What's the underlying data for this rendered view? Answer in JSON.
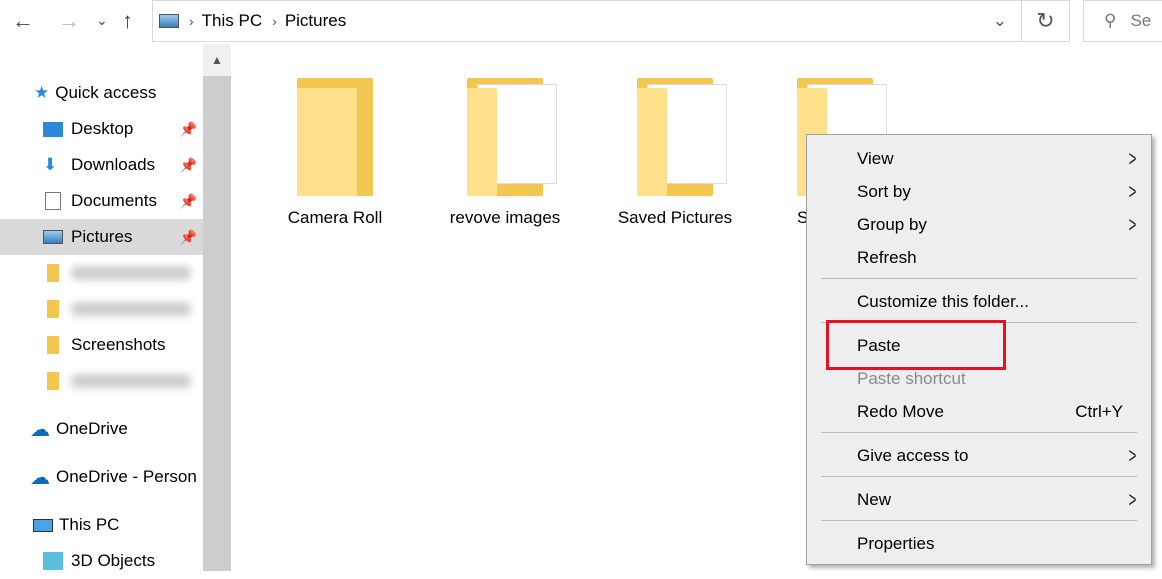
{
  "toolbar": {
    "back": "←",
    "forward": "→",
    "recent": "⌄",
    "up": "↑",
    "refresh": "↻",
    "search_placeholder": "Se"
  },
  "address": {
    "crumbs": [
      "This PC",
      "Pictures"
    ]
  },
  "sidebar": {
    "items": [
      {
        "label": "Quick access",
        "icon": "star-icon"
      },
      {
        "label": "Desktop",
        "icon": "desktop-icon",
        "pinned": true
      },
      {
        "label": "Downloads",
        "icon": "download-icon",
        "pinned": true
      },
      {
        "label": "Documents",
        "icon": "document-icon",
        "pinned": true
      },
      {
        "label": "Pictures",
        "icon": "pictures-icon",
        "pinned": true,
        "selected": true
      },
      {
        "label": "Screenshots",
        "icon": "folder-icon"
      },
      {
        "label": "OneDrive",
        "icon": "cloud-icon"
      },
      {
        "label": "OneDrive - Person",
        "icon": "cloud-icon"
      },
      {
        "label": "This PC",
        "icon": "computer-icon"
      },
      {
        "label": "3D Objects",
        "icon": "cube-icon"
      }
    ]
  },
  "folders": [
    {
      "label": "Camera Roll"
    },
    {
      "label": "revove images"
    },
    {
      "label": "Saved Pictures"
    },
    {
      "label": "S"
    }
  ],
  "context_menu": {
    "items": [
      {
        "label": "View",
        "submenu": true
      },
      {
        "label": "Sort by",
        "submenu": true
      },
      {
        "label": "Group by",
        "submenu": true
      },
      {
        "label": "Refresh"
      },
      {
        "label": "Customize this folder..."
      },
      {
        "label": "Paste",
        "highlighted": true
      },
      {
        "label": "Paste shortcut",
        "disabled": true
      },
      {
        "label": "Redo Move",
        "shortcut": "Ctrl+Y"
      },
      {
        "label": "Give access to",
        "submenu": true
      },
      {
        "label": "New",
        "submenu": true
      },
      {
        "label": "Properties"
      }
    ]
  },
  "colors": {
    "highlight_box": "#e81123",
    "folder": "#f3c74f",
    "selected_bg": "#d9d9d9"
  }
}
